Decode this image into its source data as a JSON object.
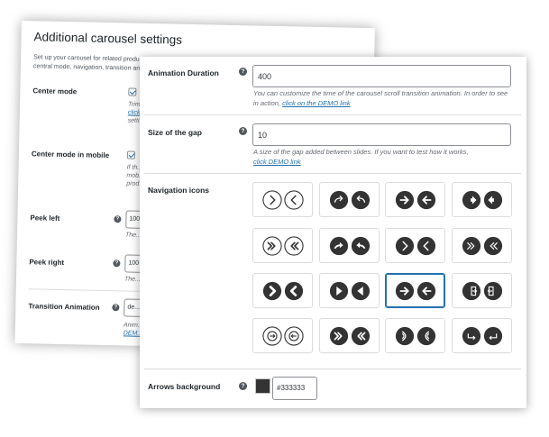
{
  "back_panel": {
    "title": "Additional carousel settings",
    "intro": "Set up your carousel for related products. We tried to give all the necessary tips right in the settings. You can set the central mode, navigation, transition animation...",
    "rows": [
      {
        "label": "Center mode",
        "desc_lines": [
          "Trim...",
          "click...",
          "setti..."
        ]
      },
      {
        "label": "Center mode in mobile",
        "desc_lines": [
          "If th...",
          "mob...",
          "prod..."
        ]
      },
      {
        "label": "Peek left",
        "value": "100",
        "desc": "The..."
      },
      {
        "label": "Peek right",
        "value": "100",
        "desc": "The..."
      },
      {
        "label": "Transition Animation",
        "value": "de...",
        "desc_lines": [
          "Anim...",
          "DEM..."
        ]
      }
    ]
  },
  "front_panel": {
    "animation_duration": {
      "label": "Animation Duration",
      "value": "400",
      "desc": "You can customize the time of the carousel scroll transition animation. In order to see in action,",
      "link": "click on the DEMO link"
    },
    "gap": {
      "label": "Size of the gap",
      "value": "10",
      "desc": "A size of the gap added between slides. If you want to test how it works,",
      "link": "click DEMO link"
    },
    "navigation_icons": {
      "label": "Navigation icons",
      "selected_index": 10,
      "icons": [
        {
          "name": "chevron-outline-icon",
          "style": "outline",
          "glyph": "chevron"
        },
        {
          "name": "curved-arrow-icon",
          "style": "filled",
          "glyph": "curve"
        },
        {
          "name": "bold-arrow-icon",
          "style": "filled",
          "glyph": "arrow"
        },
        {
          "name": "arrow-block-icon",
          "style": "filled",
          "glyph": "block"
        },
        {
          "name": "double-chevron-outline-icon",
          "style": "outline",
          "glyph": "double"
        },
        {
          "name": "hook-arrow-icon",
          "style": "filled",
          "glyph": "hook"
        },
        {
          "name": "chevron-filled-icon",
          "style": "filled",
          "glyph": "chevron"
        },
        {
          "name": "double-angle-icon",
          "style": "filled",
          "glyph": "dangle"
        },
        {
          "name": "chevron-bold-icon",
          "style": "filled",
          "glyph": "chevronbold"
        },
        {
          "name": "triangle-icon",
          "style": "filled",
          "glyph": "triangle"
        },
        {
          "name": "arrow-thin-icon",
          "style": "filled",
          "glyph": "arrow"
        },
        {
          "name": "door-exit-icon",
          "style": "filled",
          "glyph": "door"
        },
        {
          "name": "circle-arrow-icon",
          "style": "outline",
          "glyph": "circlearrow"
        },
        {
          "name": "double-chevron-filled-icon",
          "style": "filled",
          "glyph": "double"
        },
        {
          "name": "swirl-chevron-icon",
          "style": "filled",
          "glyph": "swirl"
        },
        {
          "name": "return-arrow-icon",
          "style": "filled",
          "glyph": "return"
        }
      ]
    },
    "arrows_background": {
      "label": "Arrows background",
      "value": "#333333",
      "color": "#333333"
    }
  }
}
